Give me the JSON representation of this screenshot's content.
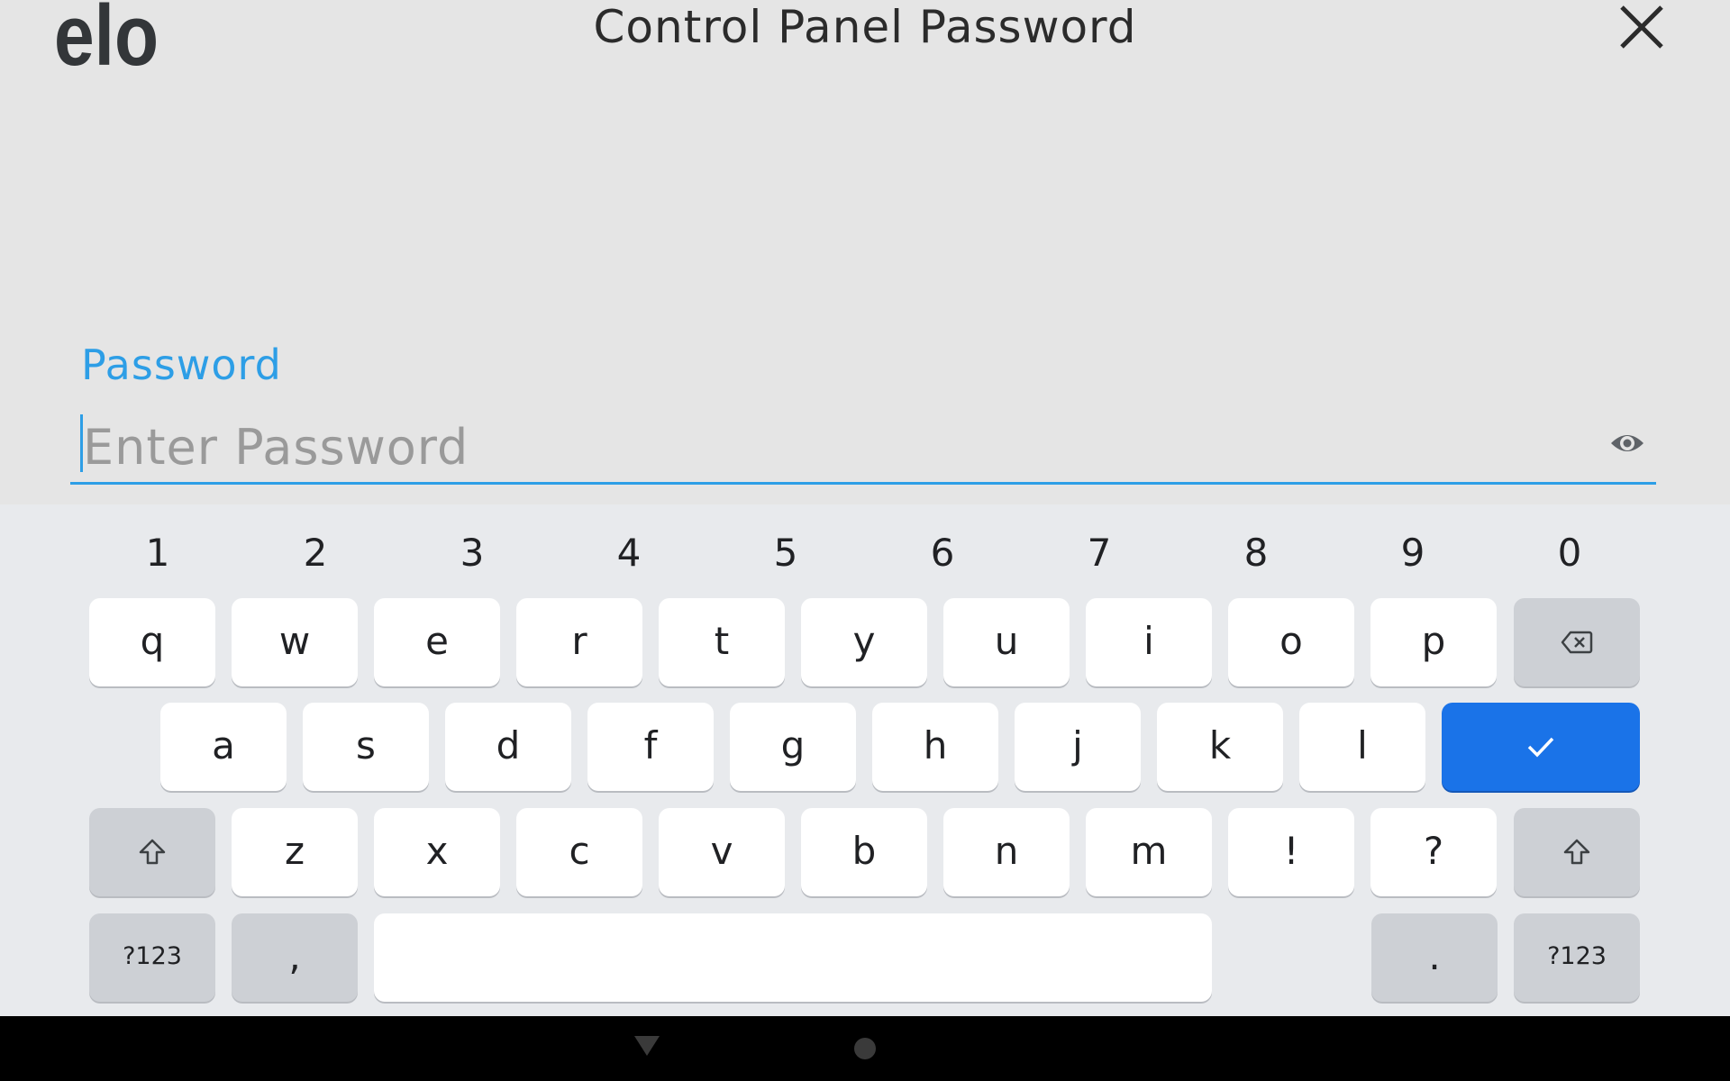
{
  "header": {
    "logo_text": "elo",
    "title": "Control Panel Password"
  },
  "form": {
    "label": "Password",
    "placeholder": "Enter Password",
    "value": ""
  },
  "keyboard": {
    "number_row": [
      "1",
      "2",
      "3",
      "4",
      "5",
      "6",
      "7",
      "8",
      "9",
      "0"
    ],
    "row1": [
      "q",
      "w",
      "e",
      "r",
      "t",
      "y",
      "u",
      "i",
      "o",
      "p"
    ],
    "row2": [
      "a",
      "s",
      "d",
      "f",
      "g",
      "h",
      "j",
      "k",
      "l"
    ],
    "row3": [
      "z",
      "x",
      "c",
      "v",
      "b",
      "n",
      "m",
      "!",
      "?"
    ],
    "row4": {
      "symbols_left": "?123",
      "comma": ",",
      "space": "",
      "period": ".",
      "symbols_right": "?123"
    },
    "icons": {
      "backspace": "backspace-icon",
      "enter": "checkmark-icon",
      "shift": "shift-icon"
    },
    "accent_color": "#1a73e8"
  },
  "colors": {
    "label_blue": "#2d9ee6",
    "background": "#e5e5e5"
  }
}
